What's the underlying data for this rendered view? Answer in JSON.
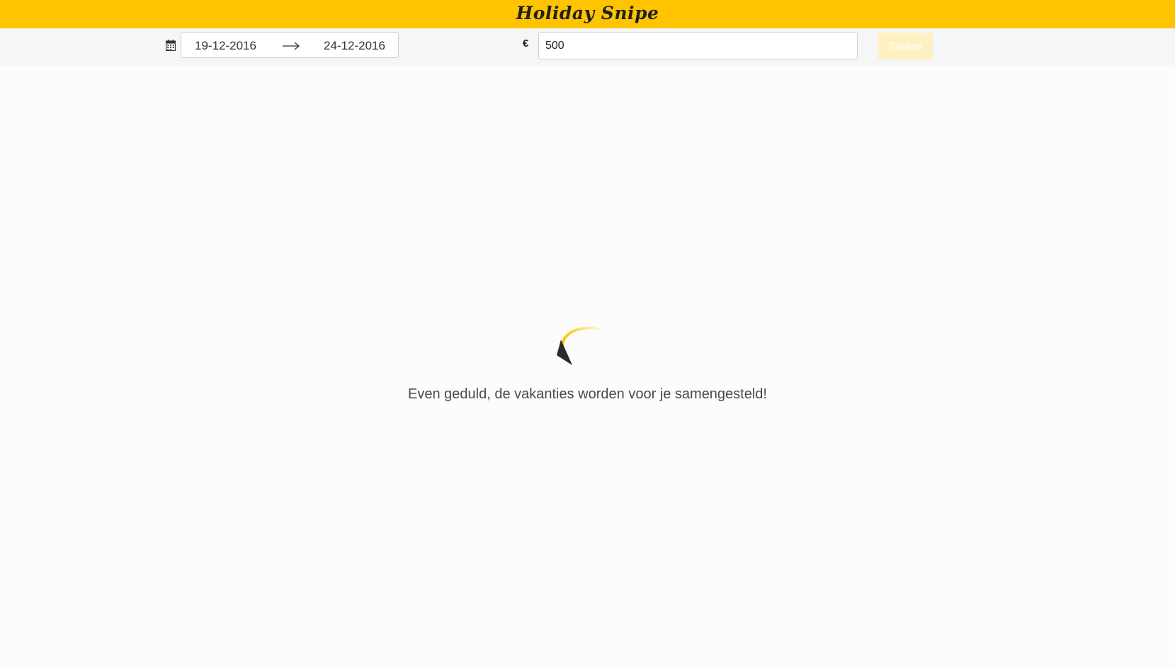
{
  "header": {
    "logo_text": "Holiday Snipe",
    "brand_color": "#ffc400"
  },
  "search": {
    "calendar_icon": "calendar-icon",
    "date_from": "19-12-2016",
    "date_arrow_icon": "arrow-right-icon",
    "date_to": "24-12-2016",
    "currency_symbol": "€",
    "budget_value": "500",
    "search_button_label": "Zoeken"
  },
  "loading": {
    "spinner_icon": "loading-spinner-icon",
    "message": "Even geduld, de vakanties worden voor je samengesteld!"
  }
}
